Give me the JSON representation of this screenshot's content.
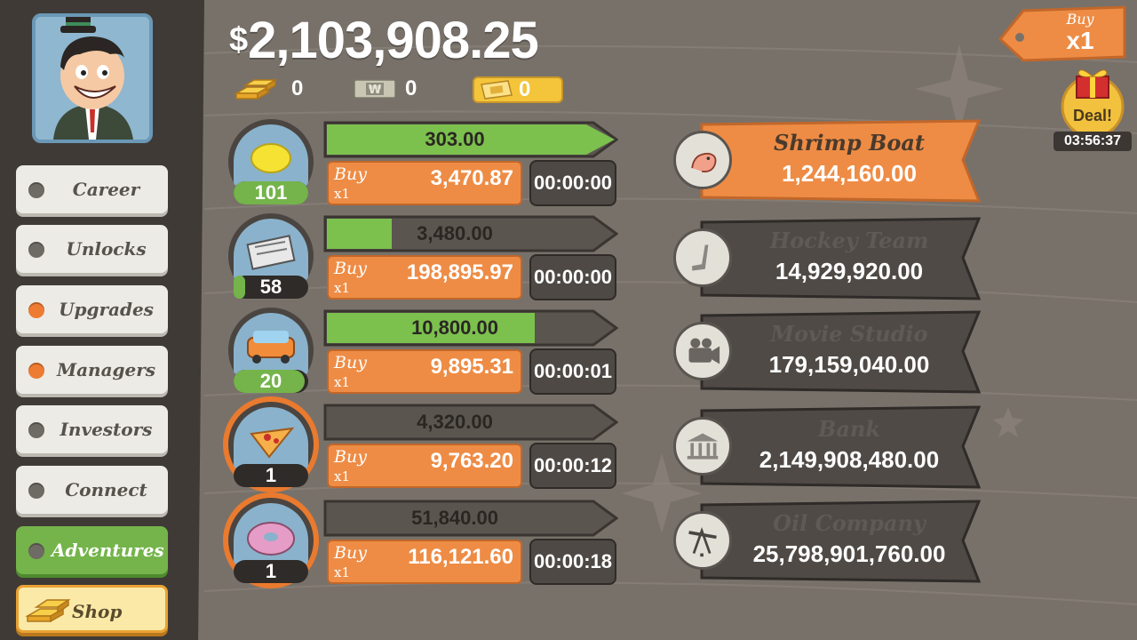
{
  "money": {
    "symbol": "$",
    "amount": "2,103,908.25"
  },
  "currencies": [
    {
      "name": "gold-bars",
      "value": "0"
    },
    {
      "name": "megabucks",
      "value": "0"
    },
    {
      "name": "tickets",
      "value": "0"
    }
  ],
  "nav": {
    "career": "Career",
    "unlocks": "Unlocks",
    "upgrades": "Upgrades",
    "managers": "Managers",
    "investors": "Investors",
    "connect": "Connect",
    "adventures": "Adventures",
    "shop": "Shop"
  },
  "businesses": [
    {
      "icon": "lemon-icon",
      "count": "101",
      "progress_value": 1.0,
      "revenue": "303.00",
      "revenue_fill": 1.0,
      "buy": "Buy",
      "mult": "x1",
      "cost": "3,470.87",
      "timer": "00:00:00",
      "highlight": false
    },
    {
      "icon": "newspaper-icon",
      "count": "58",
      "progress_value": 0.16,
      "revenue": "3,480.00",
      "revenue_fill": 0.25,
      "buy": "Buy",
      "mult": "x1",
      "cost": "198,895.97",
      "timer": "00:00:00",
      "highlight": false
    },
    {
      "icon": "car-wash-icon",
      "count": "20",
      "progress_value": 0.95,
      "revenue": "10,800.00",
      "revenue_fill": 0.8,
      "buy": "Buy",
      "mult": "x1",
      "cost": "9,895.31",
      "timer": "00:00:01",
      "highlight": false
    },
    {
      "icon": "pizza-icon",
      "count": "1",
      "progress_value": 0.0,
      "revenue": "4,320.00",
      "revenue_fill": 0.0,
      "buy": "Buy",
      "mult": "x1",
      "cost": "9,763.20",
      "timer": "00:00:12",
      "highlight": true
    },
    {
      "icon": "donut-icon",
      "count": "1",
      "progress_value": 0.0,
      "revenue": "51,840.00",
      "revenue_fill": 0.0,
      "buy": "Buy",
      "mult": "x1",
      "cost": "116,121.60",
      "timer": "00:00:18",
      "highlight": true
    }
  ],
  "upcoming": [
    {
      "icon": "shrimp-icon",
      "name": "Shrimp Boat",
      "cost": "1,244,160.00",
      "active": true
    },
    {
      "icon": "hockey-stick-icon",
      "name": "Hockey Team",
      "cost": "14,929,920.00",
      "active": false
    },
    {
      "icon": "movie-camera-icon",
      "name": "Movie Studio",
      "cost": "179,159,040.00",
      "active": false
    },
    {
      "icon": "bank-icon",
      "name": "Bank",
      "cost": "2,149,908,480.00",
      "active": false
    },
    {
      "icon": "oil-derrick-icon",
      "name": "Oil Company",
      "cost": "25,798,901,760.00",
      "active": false
    }
  ],
  "buy_multiplier": {
    "label": "Buy",
    "value": "x1"
  },
  "deal": {
    "label": "Deal!",
    "timer": "03:56:37"
  },
  "colors": {
    "accent_orange": "#ee8c45",
    "green": "#74b44a",
    "panel_dark": "#4e4944"
  }
}
